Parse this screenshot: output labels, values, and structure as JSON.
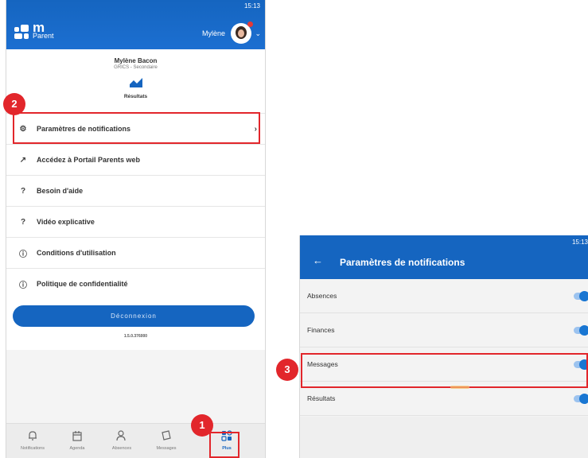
{
  "screen1": {
    "status_time": "15:13",
    "logo_m": "m",
    "logo_parent": "Parent",
    "header_user": "Mylène",
    "profile_name": "Mylène Bacon",
    "profile_school": "GRICS - Secondaire",
    "results_label": "Résultats",
    "menu": [
      {
        "label": "Paramètres de notifications",
        "icon": "gear-icon"
      },
      {
        "label": "Accédez à Portail Parents web",
        "icon": "external-link-icon"
      },
      {
        "label": "Besoin d'aide",
        "icon": "help-icon"
      },
      {
        "label": "Vidéo explicative",
        "icon": "help-icon"
      },
      {
        "label": "Conditions d'utilisation",
        "icon": "info-icon"
      },
      {
        "label": "Politique de confidentialité",
        "icon": "info-icon"
      }
    ],
    "logout_label": "Déconnexion",
    "version": "1.5.0.376000",
    "tabs": [
      {
        "label": "Notifications",
        "icon": "bell-icon"
      },
      {
        "label": "Agenda",
        "icon": "calendar-icon"
      },
      {
        "label": "Absences",
        "icon": "person-icon"
      },
      {
        "label": "Messages",
        "icon": "message-icon"
      },
      {
        "label": "Plus",
        "icon": "more-icon",
        "active": true
      }
    ]
  },
  "screen2": {
    "status_time": "15:13",
    "title": "Paramètres de notifications",
    "toggles": [
      {
        "label": "Absences",
        "on": true
      },
      {
        "label": "Finances",
        "on": true
      },
      {
        "label": "Messages",
        "on": true
      },
      {
        "label": "Résultats",
        "on": true
      }
    ]
  },
  "annotations": {
    "step1": "1",
    "step2": "2",
    "step3": "3",
    "highlight_color": "#e2262b"
  },
  "colors": {
    "brand_blue": "#1565c0",
    "toggle_track": "#9cc3ef",
    "toggle_knob": "#1976d2"
  }
}
